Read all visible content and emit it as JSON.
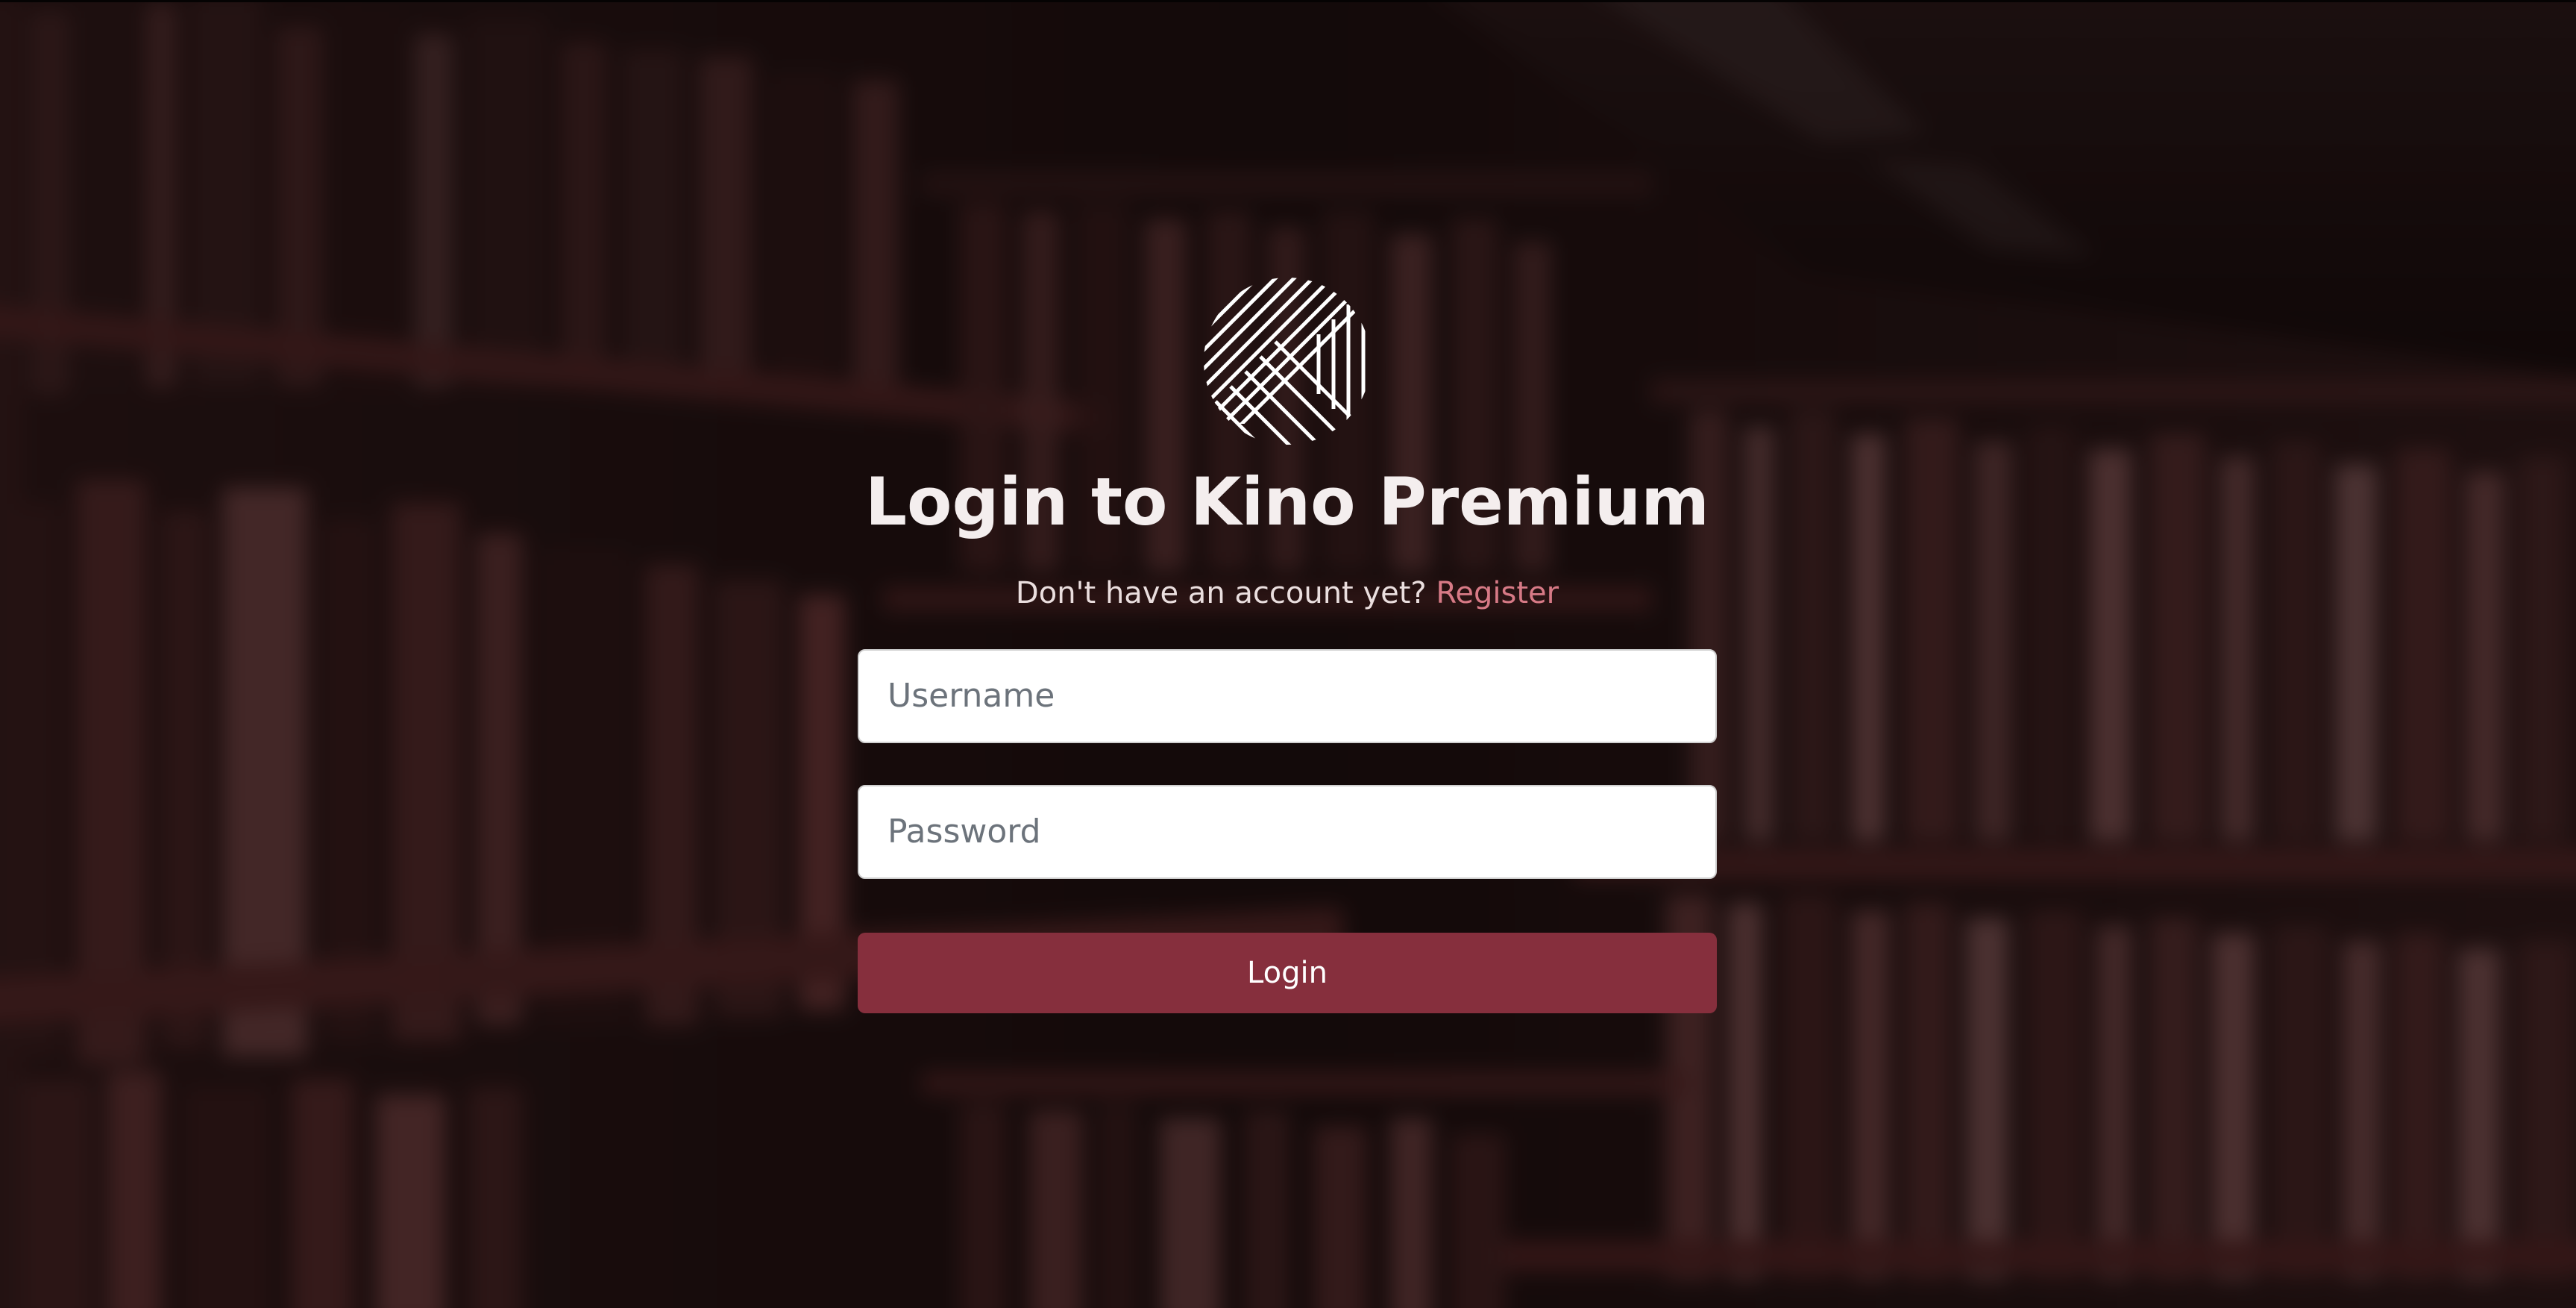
{
  "colors": {
    "accent": "#862f3d",
    "link": "#d77a86",
    "title_text": "#f4eeee",
    "background_tint": "#2a1414"
  },
  "logo": {
    "icon": "kino-logo-striped-circle-icon"
  },
  "header": {
    "title": "Login to Kino Premium"
  },
  "signup_prompt": {
    "text": "Don't have an account yet?",
    "link_label": "Register"
  },
  "form": {
    "username": {
      "placeholder": "Username",
      "value": ""
    },
    "password": {
      "placeholder": "Password",
      "value": ""
    },
    "submit_label": "Login"
  }
}
